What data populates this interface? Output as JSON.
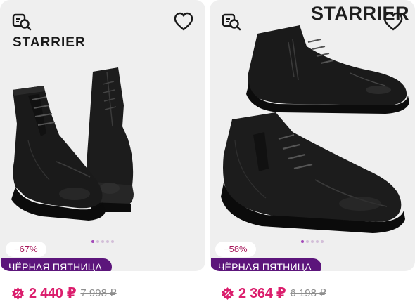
{
  "products": [
    {
      "brand": "STARRIER",
      "discount": "−67%",
      "promo": "ЧЁРНАЯ ПЯТНИЦА",
      "price": "2 440 ₽",
      "old_price": "7 998 ₽",
      "icons": {
        "similar": "find-similar-icon",
        "favorite": "heart-icon",
        "price": "discount-badge-icon"
      }
    },
    {
      "brand": "STARRIER",
      "discount": "−58%",
      "promo": "ЧЁРНАЯ ПЯТНИЦА",
      "price": "2 364 ₽",
      "old_price": "6 198 ₽",
      "icons": {
        "similar": "find-similar-icon",
        "favorite": "heart-icon",
        "price": "discount-badge-icon"
      }
    }
  ],
  "colors": {
    "card_bg": "#efefef",
    "promo_bg": "#5c157b",
    "price": "#db1e6d",
    "discount_text": "#a7165a",
    "dot_active": "#a34ab9"
  }
}
